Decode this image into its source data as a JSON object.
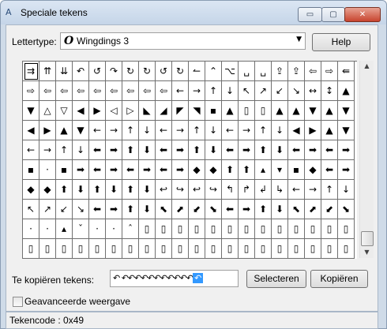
{
  "window": {
    "title": "Speciale tekens",
    "minimize": "▭",
    "maximize": "▢",
    "close": "✕",
    "icon": "A"
  },
  "font": {
    "label": "Lettertype:",
    "glyph": "O",
    "value": "Wingdings 3",
    "arrow": "▼"
  },
  "help_label": "Help",
  "grid": {
    "rows": [
      [
        "⇉",
        "⇈",
        "⇊",
        "↶",
        "↺",
        "↷",
        "↻",
        "↻",
        "↺",
        "↻",
        "↼",
        "⌃",
        "⌥",
        "␣",
        "␣",
        "⇪",
        "⇪",
        "⇦",
        "⇨",
        "⇚"
      ],
      [
        "⇨",
        "⇦",
        "⇦",
        "⇦",
        "⇦",
        "⇦",
        "⇦",
        "⇦",
        "⇦",
        "←",
        "→",
        "↑",
        "↓",
        "↖",
        "↗",
        "↙",
        "↘",
        "↔",
        "↕",
        "▲"
      ],
      [
        "▼",
        "△",
        "▽",
        "◀",
        "▶",
        "◁",
        "▷",
        "◣",
        "◢",
        "◤",
        "◥",
        "▪",
        "▲",
        "▯",
        "▯",
        "▲",
        "▲",
        "▼",
        "▲",
        "▼"
      ],
      [
        "◀",
        "▶",
        "▲",
        "▼",
        "←",
        "→",
        "↑",
        "↓",
        "←",
        "→",
        "↑",
        "↓",
        "←",
        "→",
        "↑",
        "↓",
        "◀",
        "▶",
        "▲",
        "▼"
      ],
      [
        "←",
        "→",
        "↑",
        "↓",
        "⬅",
        "➡",
        "⬆",
        "⬇",
        "⬅",
        "➡",
        "⬆",
        "⬇",
        "⬅",
        "➡",
        "⬆",
        "⬇",
        "⬅",
        "➡",
        "⬅",
        "➡"
      ],
      [
        "▪",
        "·",
        "▪",
        "➡",
        "⬅",
        "➡",
        "⬅",
        "➡",
        "⬅",
        "➡",
        "◆",
        "◆",
        "⬆",
        "⬆",
        "▴",
        "▾",
        "▪",
        "◆",
        "⬅",
        "➡"
      ],
      [
        "◆",
        "◆",
        "⬆",
        "⬇",
        "⬆",
        "⬇",
        "⬆",
        "⬇",
        "↩",
        "↪",
        "↩",
        "↪",
        "↰",
        "↱",
        "↲",
        "↳",
        "←",
        "→",
        "↑",
        "↓"
      ],
      [
        "↖",
        "↗",
        "↙",
        "↘",
        "⬅",
        "➡",
        "⬆",
        "⬇",
        "⬉",
        "⬈",
        "⬋",
        "⬊",
        "⬅",
        "➡",
        "⬆",
        "⬇",
        "⬉",
        "⬈",
        "⬋",
        "⬊"
      ],
      [
        "·",
        "·",
        "▴",
        "ˇ",
        "·",
        "·",
        "ˆ",
        "▯",
        "▯",
        "▯",
        "▯",
        "▯",
        "▯",
        "▯",
        "▯",
        "▯",
        "▯",
        "▯",
        "▯",
        "▯"
      ],
      [
        "▯",
        "▯",
        "▯",
        "▯",
        "▯",
        "▯",
        "▯",
        "▯",
        "▯",
        "▯",
        "▯",
        "▯",
        "▯",
        "▯",
        "▯",
        "▯",
        "▯",
        "▯",
        "▯",
        "▯"
      ]
    ]
  },
  "copy": {
    "label": "Te kopiëren tekens:",
    "value": "↶ ↶↶↶↶↶↶↶↶↶↶↶",
    "last": "↶"
  },
  "select_label": "Selecteren",
  "copy_label": "Kopiëren",
  "advanced": {
    "label": "Geavanceerde weergave"
  },
  "status": "Tekencode : 0x49",
  "scroll": {
    "up": "▲",
    "down": "▼"
  }
}
